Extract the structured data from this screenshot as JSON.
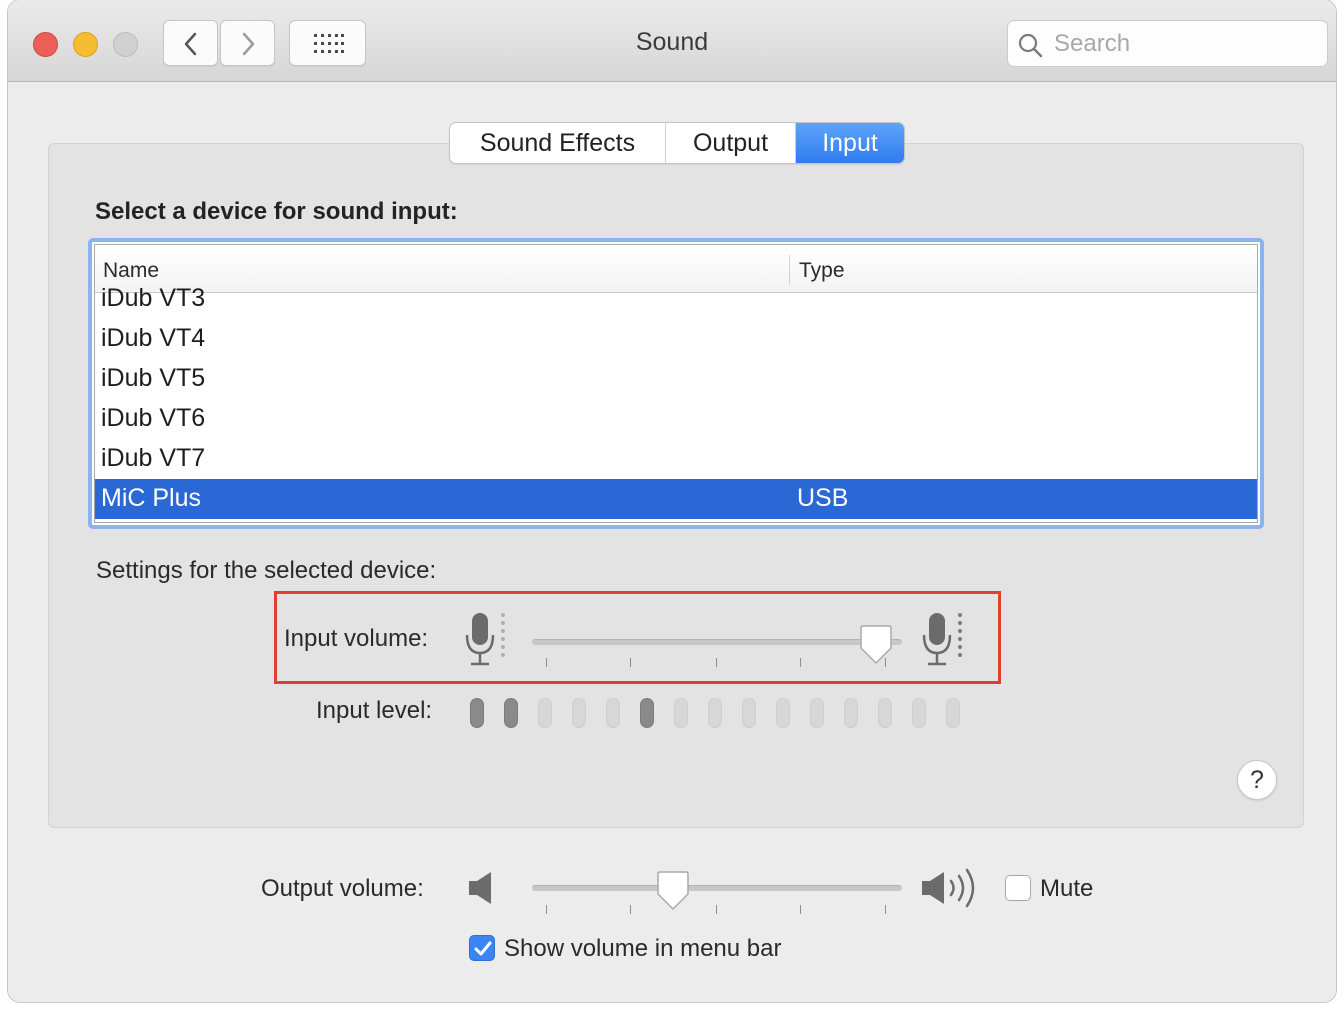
{
  "window": {
    "title": "Sound"
  },
  "search": {
    "placeholder": "Search"
  },
  "tabs": [
    {
      "label": "Sound Effects",
      "active": false
    },
    {
      "label": "Output",
      "active": false
    },
    {
      "label": "Input",
      "active": true
    }
  ],
  "input_tab": {
    "device_prompt": "Select a device for sound input:",
    "table": {
      "columns": [
        "Name",
        "Type"
      ],
      "rows": [
        {
          "name": "iDub VT3",
          "type": ""
        },
        {
          "name": "iDub VT4",
          "type": ""
        },
        {
          "name": "iDub VT5",
          "type": ""
        },
        {
          "name": "iDub VT6",
          "type": ""
        },
        {
          "name": "iDub VT7",
          "type": ""
        },
        {
          "name": "MiC Plus",
          "type": "USB",
          "selected": true
        }
      ]
    },
    "settings_label": "Settings for the selected device:",
    "input_volume_label": "Input volume:",
    "input_volume_value": 0.93,
    "input_level_label": "Input level:",
    "input_level_bars": 15,
    "input_level_active": [
      1,
      2,
      6
    ]
  },
  "help": {
    "label": "?"
  },
  "output": {
    "volume_label": "Output volume:",
    "volume_value": 0.38,
    "mute_label": "Mute",
    "mute_checked": false,
    "show_in_menubar_label": "Show volume in menu bar",
    "show_in_menubar_checked": true
  },
  "colors": {
    "accent": "#2f7cf0",
    "selection": "#2a68d6",
    "highlight_box": "#e0402f"
  },
  "icons": [
    "back-chevron-icon",
    "forward-chevron-icon",
    "grid-icon",
    "search-icon",
    "microphone-low-icon",
    "microphone-high-icon",
    "speaker-low-icon",
    "speaker-high-icon",
    "checkmark-icon",
    "help-icon"
  ]
}
